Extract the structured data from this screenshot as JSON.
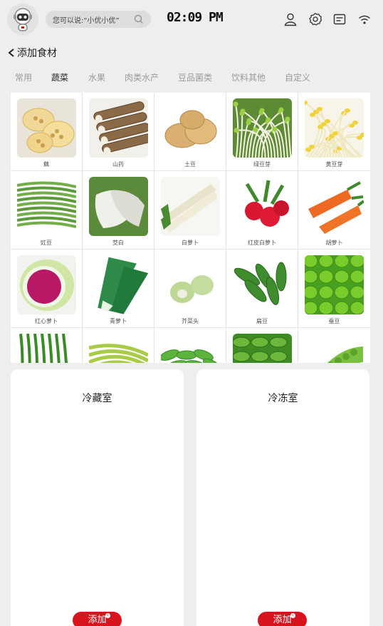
{
  "header": {
    "search_placeholder": "您可以说:“小优小优”",
    "time": "02:09 PM",
    "icons": [
      "robot-avatar-icon",
      "search-icon",
      "user-icon",
      "settings-icon",
      "message-icon",
      "wifi-icon"
    ]
  },
  "nav": {
    "back_label": "添加食材",
    "back_icon": "chevron-left-icon"
  },
  "tabs": [
    {
      "label": "常用",
      "active": false
    },
    {
      "label": "蔬菜",
      "active": true
    },
    {
      "label": "水果",
      "active": false
    },
    {
      "label": "肉类水产",
      "active": false
    },
    {
      "label": "豆品菌类",
      "active": false
    },
    {
      "label": "饮料其他",
      "active": false
    },
    {
      "label": "自定义",
      "active": false
    }
  ],
  "items": [
    {
      "name": "藕",
      "art": "lotus"
    },
    {
      "name": "山药",
      "art": "yam"
    },
    {
      "name": "土豆",
      "art": "potato"
    },
    {
      "name": "绿豆芽",
      "art": "mungsprout"
    },
    {
      "name": "黄豆芽",
      "art": "soysprout"
    },
    {
      "name": "豇豆",
      "art": "longbean"
    },
    {
      "name": "茭白",
      "art": "wildrice"
    },
    {
      "name": "白萝卜",
      "art": "whiteradish"
    },
    {
      "name": "红皮白萝卜",
      "art": "redradish"
    },
    {
      "name": "胡萝卜",
      "art": "carrot"
    },
    {
      "name": "红心萝卜",
      "art": "watermelonradish"
    },
    {
      "name": "青萝卜",
      "art": "greenradish"
    },
    {
      "name": "芥菜头",
      "art": "kohlrabi"
    },
    {
      "name": "扁豆",
      "art": "flatbean"
    },
    {
      "name": "蚕豆",
      "art": "broadbean"
    },
    {
      "name": "",
      "art": "greenbean"
    },
    {
      "name": "",
      "art": "yellowbean"
    },
    {
      "name": "",
      "art": "snowpea"
    },
    {
      "name": "",
      "art": "edamame"
    },
    {
      "name": "",
      "art": "peapod"
    }
  ],
  "fridge": {
    "title": "冷藏室",
    "add_label": "添加",
    "badge": "c"
  },
  "freezer": {
    "title": "冷冻室",
    "add_label": "添加",
    "badge": "c"
  }
}
